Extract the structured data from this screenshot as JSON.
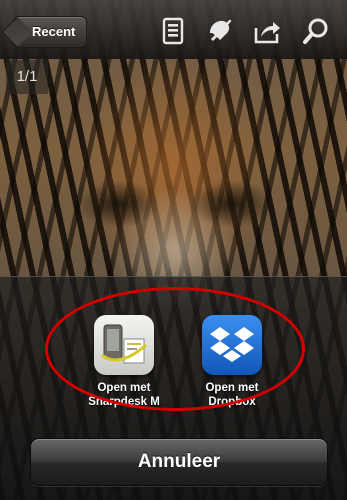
{
  "navbar": {
    "back_label": "Recent",
    "icons": [
      "thumbnails-icon",
      "bookmark-icon",
      "share-icon",
      "search-icon"
    ]
  },
  "viewer": {
    "page_counter": "1/1"
  },
  "action_sheet": {
    "apps": [
      {
        "line1": "Open met",
        "line2": "Sharpdesk M",
        "icon": "sharpdesk-app-icon"
      },
      {
        "line1": "Open met",
        "line2": "Dropbox",
        "icon": "dropbox-app-icon"
      }
    ],
    "cancel_label": "Annuleer"
  },
  "colors": {
    "highlight": "#d40000",
    "dropbox_blue": "#1b6fd6"
  }
}
